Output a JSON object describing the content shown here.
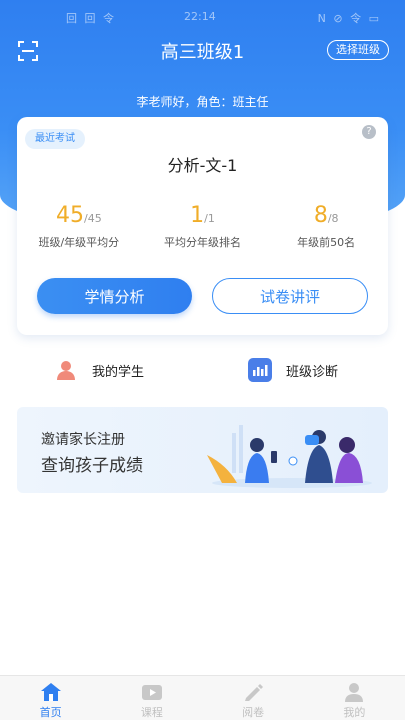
{
  "status_bar": {
    "left": "回 回 令",
    "time": "22:14",
    "right": "N ⊘ 令 ▭"
  },
  "header": {
    "title": "高三班级1",
    "select_class_label": "选择班级",
    "greeting": "李老师好，角色：班主任"
  },
  "exam_card": {
    "badge": "最近考试",
    "help": "?",
    "exam_name": "分析-文-1",
    "stats": [
      {
        "value": "45",
        "total": "/45",
        "label": "班级/年级平均分"
      },
      {
        "value": "1",
        "total": "/1",
        "label": "平均分年级排名"
      },
      {
        "value": "8",
        "total": "/8",
        "label": "年级前50名"
      }
    ],
    "primary_button": "学情分析",
    "secondary_button": "试卷讲评"
  },
  "quick_links": [
    {
      "label": "我的学生",
      "icon": "student-icon"
    },
    {
      "label": "班级诊断",
      "icon": "chart-icon"
    }
  ],
  "banner": {
    "line1": "邀请家长注册",
    "line2": "查询孩子成绩"
  },
  "tabs": [
    {
      "label": "首页",
      "icon": "home-icon",
      "active": true
    },
    {
      "label": "课程",
      "icon": "video-icon",
      "active": false
    },
    {
      "label": "阅卷",
      "icon": "pencil-icon",
      "active": false
    },
    {
      "label": "我的",
      "icon": "user-icon",
      "active": false
    }
  ],
  "colors": {
    "primary": "#2f7ff0",
    "accent_number": "#f0ad28",
    "student_icon": "#f08a7a",
    "chart_icon": "#4a7ee8"
  }
}
